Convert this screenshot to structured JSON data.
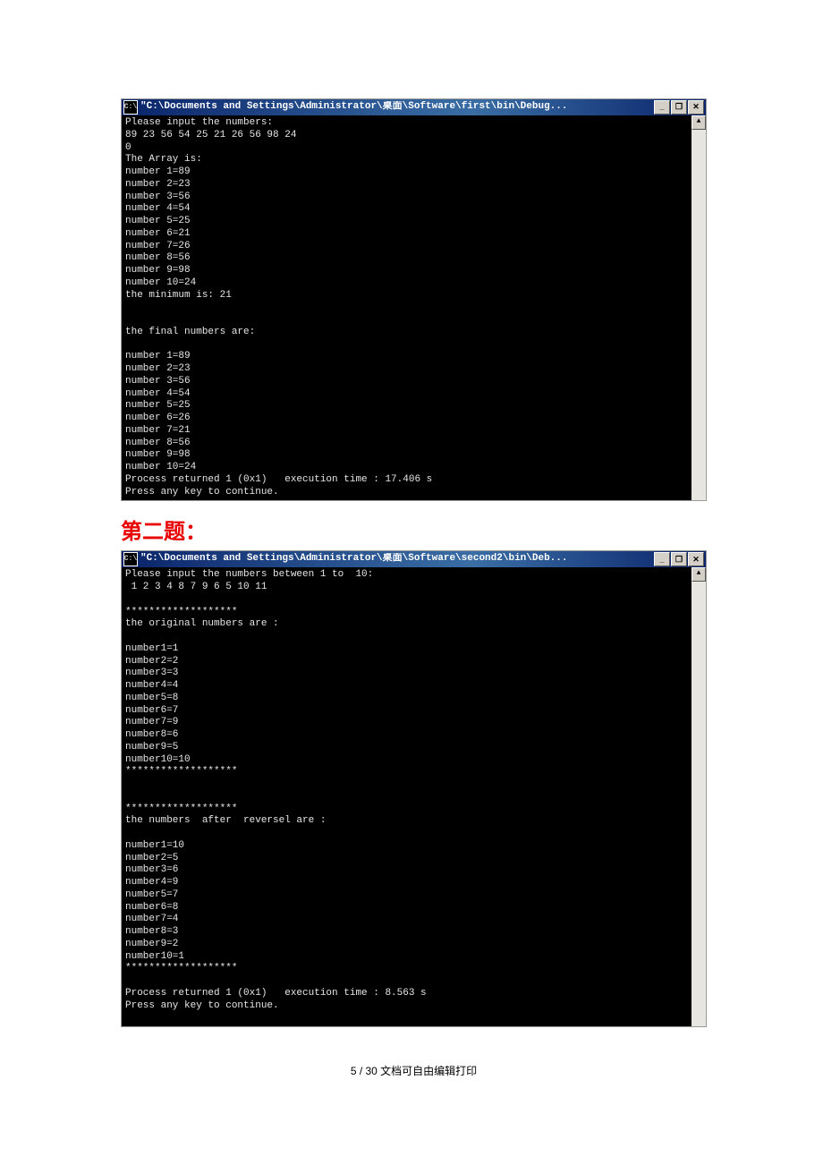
{
  "console1": {
    "title_prefix": "\"C:\\Documents and Settings\\Administrator\\桌面\\Software\\first\\bin\\Debug...",
    "icon_label": "C:\\",
    "lines": [
      "Please input the numbers:",
      "89 23 56 54 25 21 26 56 98 24",
      "0",
      "The Array is:",
      "number 1=89",
      "number 2=23",
      "number 3=56",
      "number 4=54",
      "number 5=25",
      "number 6=21",
      "number 7=26",
      "number 8=56",
      "number 9=98",
      "number 10=24",
      "the minimum is: 21",
      "",
      "",
      "the final numbers are:",
      "",
      "number 1=89",
      "number 2=23",
      "number 3=56",
      "number 4=54",
      "number 5=25",
      "number 6=26",
      "number 7=21",
      "number 8=56",
      "number 9=98",
      "number 10=24",
      "Process returned 1 (0x1)   execution time : 17.406 s",
      "Press any key to continue.",
      ""
    ]
  },
  "heading": "第二题：",
  "console2": {
    "title_prefix": "\"C:\\Documents and Settings\\Administrator\\桌面\\Software\\second2\\bin\\Deb...",
    "icon_label": "C:\\",
    "lines": [
      "Please input the numbers between 1 to  10:",
      " 1 2 3 4 8 7 9 6 5 10 11",
      "",
      "*******************",
      "the original numbers are :",
      "",
      "number1=1",
      "number2=2",
      "number3=3",
      "number4=4",
      "number5=8",
      "number6=7",
      "number7=9",
      "number8=6",
      "number9=5",
      "number10=10",
      "*******************",
      "",
      "",
      "*******************",
      "the numbers  after  reversel are :",
      "",
      "number1=10",
      "number2=5",
      "number3=6",
      "number4=9",
      "number5=7",
      "number6=8",
      "number7=4",
      "number8=3",
      "number9=2",
      "number10=1",
      "*******************",
      "",
      "Process returned 1 (0x1)   execution time : 8.563 s",
      "Press any key to continue.",
      "",
      ""
    ]
  },
  "win_buttons": {
    "min": "_",
    "max": "❐",
    "close": "✕"
  },
  "scroll": {
    "up": "▲",
    "down": "▼"
  },
  "footer": "5 / 30 文档可自由编辑打印"
}
